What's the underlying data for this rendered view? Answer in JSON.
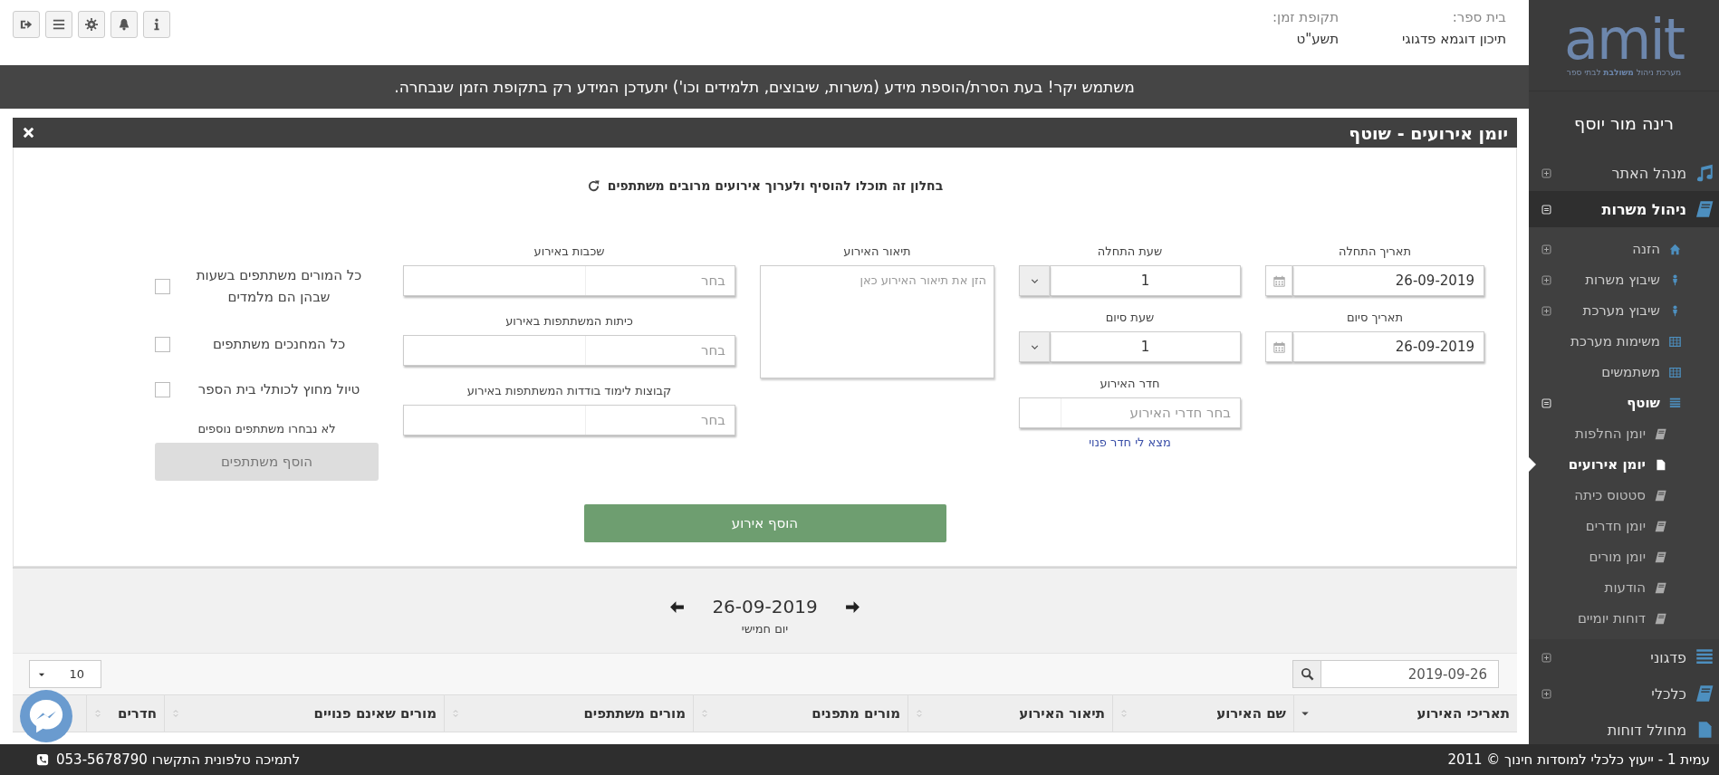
{
  "header": {
    "school_label": "בית ספר:",
    "school": "תיכון דוגמא פדגוגי",
    "period_label": "תקופת זמן:",
    "period": "תשע\"ט"
  },
  "notice": "משתמש יקר! בעת הסרת/הוספת מידע (משרות, שיבוצים, תלמידים וכו') יתעדכן המידע רק בתקופת הזמן שנבחרה.",
  "panel": {
    "title": "יומן אירועים - שוטף",
    "intro": "בחלון זה תוכלו להוסיף ולערוך אירועים מרובים משתתפים",
    "start_date": {
      "label": "תאריך התחלה",
      "value": "26-09-2019"
    },
    "end_date": {
      "label": "תאריך סיום",
      "value": "26-09-2019"
    },
    "start_hour": {
      "label": "שעת התחלה",
      "value": "1"
    },
    "end_hour": {
      "label": "שעת סיום",
      "value": "1"
    },
    "room": {
      "label": "חדר האירוע",
      "placeholder": "בחר חדרי האירוע",
      "link": "מצא לי חדר פנוי"
    },
    "description": {
      "label": "תיאור האירוע",
      "placeholder": "הזן את תיאור האירוע כאן"
    },
    "selects": [
      {
        "label": "שכבות באירוע",
        "placeholder": "בחר"
      },
      {
        "label": "כיתות המשתתפות באירוע",
        "placeholder": "בחר"
      },
      {
        "label": "קבוצות לימוד בודדות המשתתפות באירוע",
        "placeholder": "בחר"
      }
    ],
    "checkboxes": [
      {
        "label": "כל המורים משתתפים בשעות שבהן הם מלמדים",
        "checked": false
      },
      {
        "label": "כל המחנכים משתתפים",
        "checked": false
      },
      {
        "label": "טיול מחוץ לכותלי בית הספר",
        "checked": false
      }
    ],
    "participants_note": "לא נבחרו משתתפים נוספים",
    "add_participants_button": {
      "label": "הוסף משתתפים",
      "disabled": true
    },
    "add_event_button": "הוסף אירוע"
  },
  "date_nav": {
    "date": "26-09-2019",
    "weekday": "יום חמישי"
  },
  "table": {
    "search": "2019-09-26",
    "page_size": "10",
    "columns": [
      {
        "label": "תאריכי האירוע",
        "sorted": true
      },
      {
        "label": "שם האירוע",
        "sorted": false
      },
      {
        "label": "תיאור האירוע",
        "sorted": false
      },
      {
        "label": "מורים מתפנים",
        "sorted": false
      },
      {
        "label": "מורים משתתפים",
        "sorted": false
      },
      {
        "label": "מורים שאינם פנויים",
        "sorted": false
      },
      {
        "label": "חדרים",
        "sorted": false
      }
    ]
  },
  "sidebar": {
    "logo": "amit",
    "tagline": "מערכת ניהול **משולבת** לבתי ספר",
    "user": "רינה מור יוסף",
    "items": [
      {
        "label": "מנהל האתר",
        "expanded": false,
        "selected": false
      },
      {
        "label": "ניהול משרות",
        "expanded": true,
        "selected": false,
        "children": [
          {
            "label": "הזנה",
            "expanded": false,
            "selected": false
          },
          {
            "label": "שיבוץ משרות",
            "expanded": false,
            "selected": false
          },
          {
            "label": "שיבוץ מערכת",
            "expanded": false,
            "selected": false
          },
          {
            "label": "משימות מערכת",
            "selected": false
          },
          {
            "label": "משתמשים",
            "selected": false
          },
          {
            "label": "שוטף",
            "expanded": true,
            "selected": false,
            "children": [
              {
                "label": "יומן החלפות",
                "selected": false
              },
              {
                "label": "יומן אירועים",
                "selected": true
              },
              {
                "label": "סטטוס כיתה",
                "selected": false
              },
              {
                "label": "יומן חדרים",
                "selected": false
              },
              {
                "label": "יומן מורים",
                "selected": false
              },
              {
                "label": "הודעות",
                "selected": false
              },
              {
                "label": "דוחות יומיים",
                "selected": false
              }
            ]
          }
        ]
      },
      {
        "label": "פדגוני",
        "expanded": false,
        "selected": false
      },
      {
        "label": "כלכלי",
        "expanded": false,
        "selected": false
      },
      {
        "label": "מחולל דוחות",
        "selected": false
      }
    ]
  },
  "footer": {
    "copyright": "עמית 1 - ייעוץ כלכלי למוסדות חינוך © 2011",
    "support": "לתמיכה טלפונית התקשרו 053-5678790"
  }
}
